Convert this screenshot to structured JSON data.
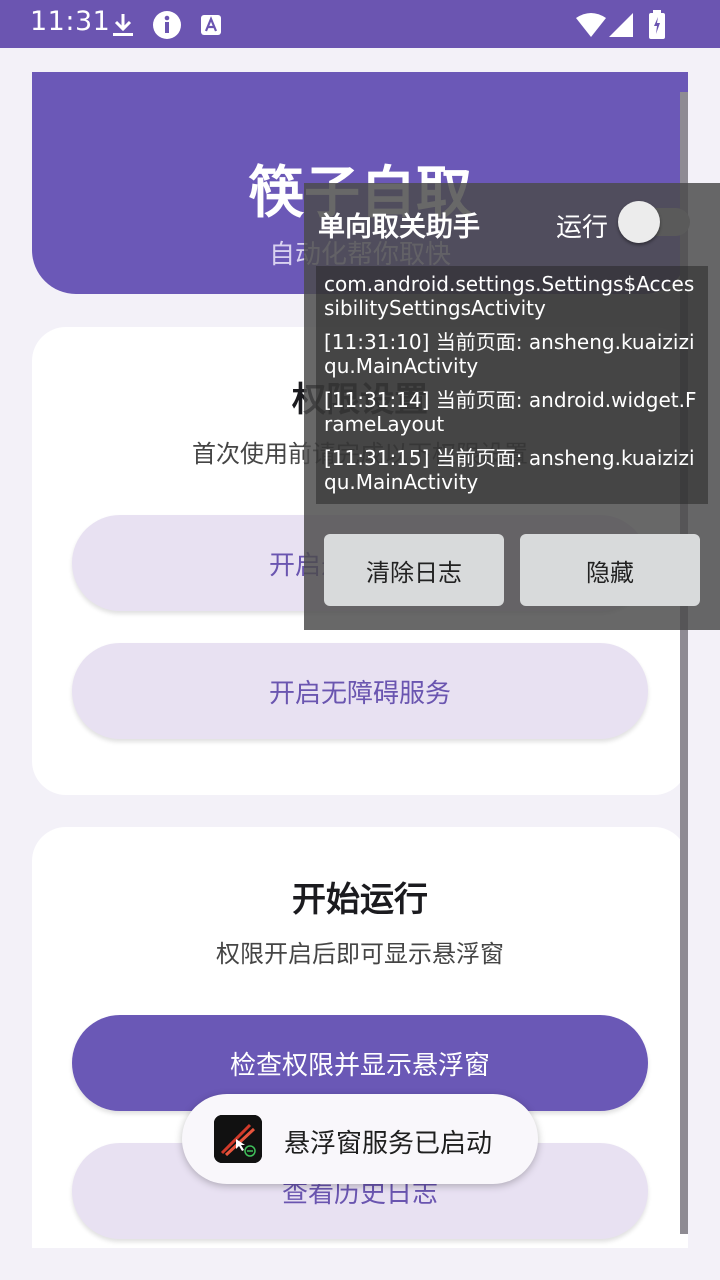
{
  "status_bar": {
    "time": "11:31",
    "icons": [
      "download-icon",
      "info-icon",
      "a-letter-icon",
      "wifi-icon",
      "signal-icon",
      "battery-charging-icon"
    ],
    "background": "#6b55b1"
  },
  "header": {
    "title": "筷子自取",
    "subtitle": "自动化帮你取快"
  },
  "permission_card": {
    "title": "权限设置",
    "description": "首次使用前请完成以下权限设置",
    "overlay_button_label": "开启悬浮窗权限",
    "accessibility_button_label": "开启无障碍服务"
  },
  "run_card": {
    "title": "开始运行",
    "description": "权限开启后即可显示悬浮窗",
    "show_overlay_button_label": "检查权限并显示悬浮窗",
    "history_button_label": "查看历史日志"
  },
  "overlay": {
    "title": "单向取关助手",
    "run_label": "运行",
    "run_enabled": false,
    "log_lines": [
      "com.android.settings.Settings$AccessibilitySettingsActivity",
      "[11:31:10] 当前页面: ansheng.kuaiziziqu.MainActivity",
      "[11:31:14] 当前页面: android.widget.FrameLayout",
      "[11:31:15] 当前页面: ansheng.kuaiziziqu.MainActivity"
    ],
    "clear_button_label": "清除日志",
    "hide_button_label": "隐藏"
  },
  "toast": {
    "message": "悬浮窗服务已启动",
    "icon": "chopsticks-app-icon"
  },
  "colors": {
    "accent": "#6b58b7",
    "accent_light": "#e8e1f2",
    "background": "#f3f1f8"
  }
}
